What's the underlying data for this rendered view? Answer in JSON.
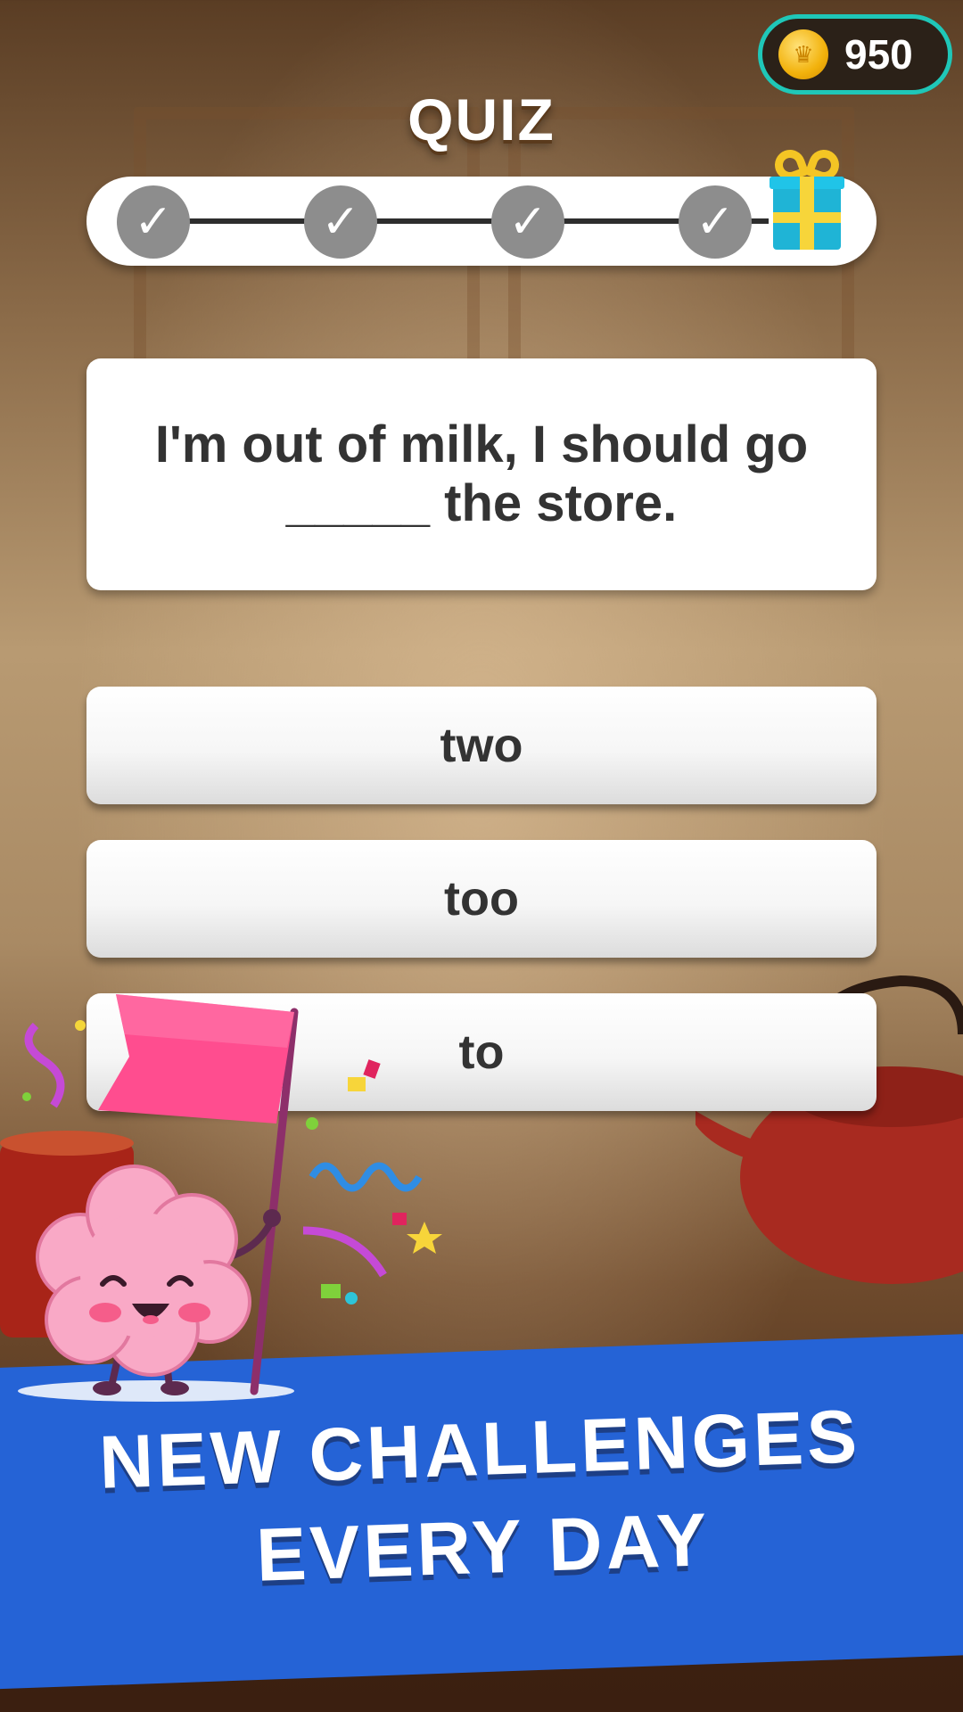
{
  "header": {
    "coins": "950",
    "title": "QUIZ"
  },
  "progress": {
    "steps_completed": 4,
    "steps_total": 4,
    "step_icon": "check-icon",
    "reward_icon": "gift-icon"
  },
  "question": {
    "text": "I'm out of milk, I should go\n_____  the store."
  },
  "answers": [
    {
      "label": "two"
    },
    {
      "label": "too"
    },
    {
      "label": "to"
    }
  ],
  "banner": {
    "text": "NEW CHALLENGES\nEVERY DAY"
  },
  "colors": {
    "banner": "#2563d6",
    "coin_border": "#1fc7b8",
    "step_done": "#8d8d8d",
    "flag": "#ff4d8f",
    "brain": "#f9a9c6"
  }
}
